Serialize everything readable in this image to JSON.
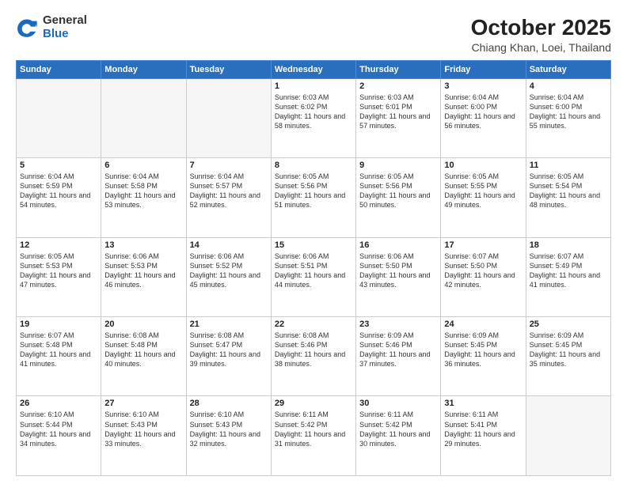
{
  "header": {
    "logo_general": "General",
    "logo_blue": "Blue",
    "month": "October 2025",
    "location": "Chiang Khan, Loei, Thailand"
  },
  "days_of_week": [
    "Sunday",
    "Monday",
    "Tuesday",
    "Wednesday",
    "Thursday",
    "Friday",
    "Saturday"
  ],
  "weeks": [
    [
      {
        "day": "",
        "empty": true
      },
      {
        "day": "",
        "empty": true
      },
      {
        "day": "",
        "empty": true
      },
      {
        "day": "1",
        "sunrise": "6:03 AM",
        "sunset": "6:02 PM",
        "daylight": "11 hours and 58 minutes."
      },
      {
        "day": "2",
        "sunrise": "6:03 AM",
        "sunset": "6:01 PM",
        "daylight": "11 hours and 57 minutes."
      },
      {
        "day": "3",
        "sunrise": "6:04 AM",
        "sunset": "6:00 PM",
        "daylight": "11 hours and 56 minutes."
      },
      {
        "day": "4",
        "sunrise": "6:04 AM",
        "sunset": "6:00 PM",
        "daylight": "11 hours and 55 minutes."
      }
    ],
    [
      {
        "day": "5",
        "sunrise": "6:04 AM",
        "sunset": "5:59 PM",
        "daylight": "11 hours and 54 minutes."
      },
      {
        "day": "6",
        "sunrise": "6:04 AM",
        "sunset": "5:58 PM",
        "daylight": "11 hours and 53 minutes."
      },
      {
        "day": "7",
        "sunrise": "6:04 AM",
        "sunset": "5:57 PM",
        "daylight": "11 hours and 52 minutes."
      },
      {
        "day": "8",
        "sunrise": "6:05 AM",
        "sunset": "5:56 PM",
        "daylight": "11 hours and 51 minutes."
      },
      {
        "day": "9",
        "sunrise": "6:05 AM",
        "sunset": "5:56 PM",
        "daylight": "11 hours and 50 minutes."
      },
      {
        "day": "10",
        "sunrise": "6:05 AM",
        "sunset": "5:55 PM",
        "daylight": "11 hours and 49 minutes."
      },
      {
        "day": "11",
        "sunrise": "6:05 AM",
        "sunset": "5:54 PM",
        "daylight": "11 hours and 48 minutes."
      }
    ],
    [
      {
        "day": "12",
        "sunrise": "6:05 AM",
        "sunset": "5:53 PM",
        "daylight": "11 hours and 47 minutes."
      },
      {
        "day": "13",
        "sunrise": "6:06 AM",
        "sunset": "5:53 PM",
        "daylight": "11 hours and 46 minutes."
      },
      {
        "day": "14",
        "sunrise": "6:06 AM",
        "sunset": "5:52 PM",
        "daylight": "11 hours and 45 minutes."
      },
      {
        "day": "15",
        "sunrise": "6:06 AM",
        "sunset": "5:51 PM",
        "daylight": "11 hours and 44 minutes."
      },
      {
        "day": "16",
        "sunrise": "6:06 AM",
        "sunset": "5:50 PM",
        "daylight": "11 hours and 43 minutes."
      },
      {
        "day": "17",
        "sunrise": "6:07 AM",
        "sunset": "5:50 PM",
        "daylight": "11 hours and 42 minutes."
      },
      {
        "day": "18",
        "sunrise": "6:07 AM",
        "sunset": "5:49 PM",
        "daylight": "11 hours and 41 minutes."
      }
    ],
    [
      {
        "day": "19",
        "sunrise": "6:07 AM",
        "sunset": "5:48 PM",
        "daylight": "11 hours and 41 minutes."
      },
      {
        "day": "20",
        "sunrise": "6:08 AM",
        "sunset": "5:48 PM",
        "daylight": "11 hours and 40 minutes."
      },
      {
        "day": "21",
        "sunrise": "6:08 AM",
        "sunset": "5:47 PM",
        "daylight": "11 hours and 39 minutes."
      },
      {
        "day": "22",
        "sunrise": "6:08 AM",
        "sunset": "5:46 PM",
        "daylight": "11 hours and 38 minutes."
      },
      {
        "day": "23",
        "sunrise": "6:09 AM",
        "sunset": "5:46 PM",
        "daylight": "11 hours and 37 minutes."
      },
      {
        "day": "24",
        "sunrise": "6:09 AM",
        "sunset": "5:45 PM",
        "daylight": "11 hours and 36 minutes."
      },
      {
        "day": "25",
        "sunrise": "6:09 AM",
        "sunset": "5:45 PM",
        "daylight": "11 hours and 35 minutes."
      }
    ],
    [
      {
        "day": "26",
        "sunrise": "6:10 AM",
        "sunset": "5:44 PM",
        "daylight": "11 hours and 34 minutes."
      },
      {
        "day": "27",
        "sunrise": "6:10 AM",
        "sunset": "5:43 PM",
        "daylight": "11 hours and 33 minutes."
      },
      {
        "day": "28",
        "sunrise": "6:10 AM",
        "sunset": "5:43 PM",
        "daylight": "11 hours and 32 minutes."
      },
      {
        "day": "29",
        "sunrise": "6:11 AM",
        "sunset": "5:42 PM",
        "daylight": "11 hours and 31 minutes."
      },
      {
        "day": "30",
        "sunrise": "6:11 AM",
        "sunset": "5:42 PM",
        "daylight": "11 hours and 30 minutes."
      },
      {
        "day": "31",
        "sunrise": "6:11 AM",
        "sunset": "5:41 PM",
        "daylight": "11 hours and 29 minutes."
      },
      {
        "day": "",
        "empty": true
      }
    ]
  ]
}
